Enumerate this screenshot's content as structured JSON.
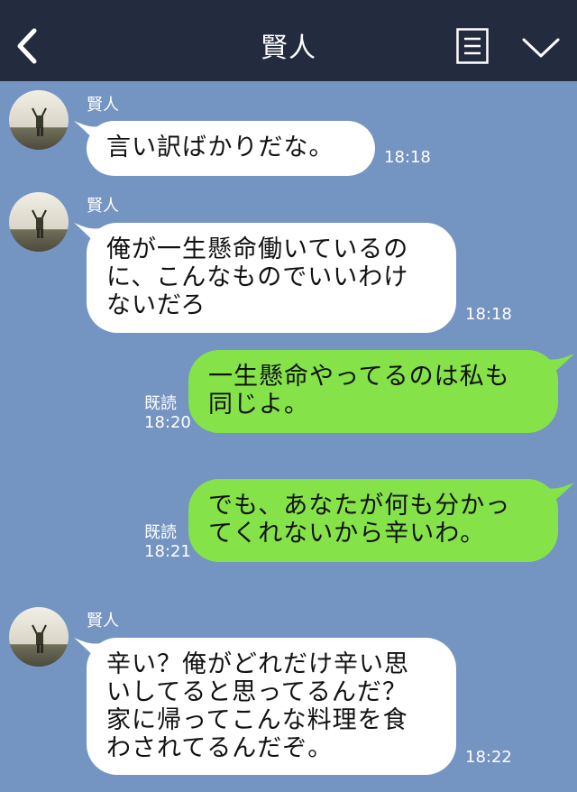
{
  "header": {
    "title": "賢人",
    "back_icon": "chevron-left-icon",
    "notes_icon": "note-icon",
    "menu_icon": "chevron-down-icon"
  },
  "colors": {
    "background": "#7494c2",
    "header": "#232b3f",
    "incoming_bubble": "#ffffff",
    "outgoing_bubble": "#85e249"
  },
  "messages": [
    {
      "side": "in",
      "sender": "賢人",
      "text": "言い訳ばかりだな。",
      "time": "18:18"
    },
    {
      "side": "in",
      "sender": "賢人",
      "text": "俺が一生懸命働いているの\nに、こんなものでいいわけ\nないだろ",
      "time": "18:18"
    },
    {
      "side": "out",
      "read": "既読",
      "text": "一生懸命やってるのは私も\n同じよ。",
      "time": "18:20"
    },
    {
      "side": "out",
      "read": "既読",
      "text": "でも、あなたが何も分かっ\nてくれないから辛いわ。",
      "time": "18:21"
    },
    {
      "side": "in",
      "sender": "賢人",
      "text": "辛い？俺がどれだけ辛い思\nいしてると思ってるんだ？\n家に帰ってこんな料理を食\nわされてるんだぞ。",
      "time": "18:22"
    }
  ]
}
